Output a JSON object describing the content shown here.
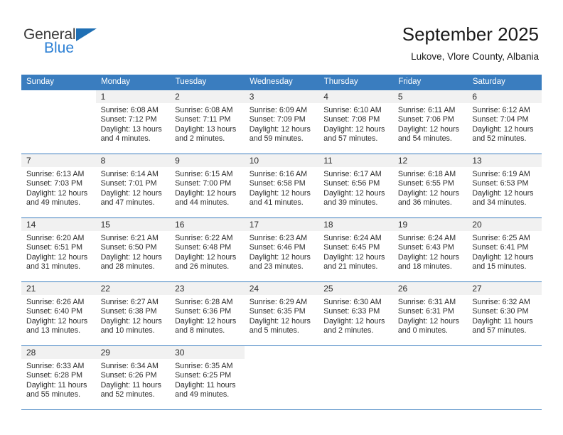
{
  "brand": {
    "name_top": "General",
    "name_bottom": "Blue",
    "accent_color": "#2b7fd4",
    "triangle_color": "#1f6fb4"
  },
  "header": {
    "title": "September 2025",
    "subtitle": "Lukove, Vlore County, Albania",
    "header_bg": "#3a7dbf",
    "header_text_color": "#ffffff"
  },
  "weekdays": [
    "Sunday",
    "Monday",
    "Tuesday",
    "Wednesday",
    "Thursday",
    "Friday",
    "Saturday"
  ],
  "weeks": [
    [
      {
        "day": "",
        "sunrise": "",
        "sunset": "",
        "daylight1": "",
        "daylight2": ""
      },
      {
        "day": "1",
        "sunrise": "Sunrise: 6:08 AM",
        "sunset": "Sunset: 7:12 PM",
        "daylight1": "Daylight: 13 hours",
        "daylight2": "and 4 minutes."
      },
      {
        "day": "2",
        "sunrise": "Sunrise: 6:08 AM",
        "sunset": "Sunset: 7:11 PM",
        "daylight1": "Daylight: 13 hours",
        "daylight2": "and 2 minutes."
      },
      {
        "day": "3",
        "sunrise": "Sunrise: 6:09 AM",
        "sunset": "Sunset: 7:09 PM",
        "daylight1": "Daylight: 12 hours",
        "daylight2": "and 59 minutes."
      },
      {
        "day": "4",
        "sunrise": "Sunrise: 6:10 AM",
        "sunset": "Sunset: 7:08 PM",
        "daylight1": "Daylight: 12 hours",
        "daylight2": "and 57 minutes."
      },
      {
        "day": "5",
        "sunrise": "Sunrise: 6:11 AM",
        "sunset": "Sunset: 7:06 PM",
        "daylight1": "Daylight: 12 hours",
        "daylight2": "and 54 minutes."
      },
      {
        "day": "6",
        "sunrise": "Sunrise: 6:12 AM",
        "sunset": "Sunset: 7:04 PM",
        "daylight1": "Daylight: 12 hours",
        "daylight2": "and 52 minutes."
      }
    ],
    [
      {
        "day": "7",
        "sunrise": "Sunrise: 6:13 AM",
        "sunset": "Sunset: 7:03 PM",
        "daylight1": "Daylight: 12 hours",
        "daylight2": "and 49 minutes."
      },
      {
        "day": "8",
        "sunrise": "Sunrise: 6:14 AM",
        "sunset": "Sunset: 7:01 PM",
        "daylight1": "Daylight: 12 hours",
        "daylight2": "and 47 minutes."
      },
      {
        "day": "9",
        "sunrise": "Sunrise: 6:15 AM",
        "sunset": "Sunset: 7:00 PM",
        "daylight1": "Daylight: 12 hours",
        "daylight2": "and 44 minutes."
      },
      {
        "day": "10",
        "sunrise": "Sunrise: 6:16 AM",
        "sunset": "Sunset: 6:58 PM",
        "daylight1": "Daylight: 12 hours",
        "daylight2": "and 41 minutes."
      },
      {
        "day": "11",
        "sunrise": "Sunrise: 6:17 AM",
        "sunset": "Sunset: 6:56 PM",
        "daylight1": "Daylight: 12 hours",
        "daylight2": "and 39 minutes."
      },
      {
        "day": "12",
        "sunrise": "Sunrise: 6:18 AM",
        "sunset": "Sunset: 6:55 PM",
        "daylight1": "Daylight: 12 hours",
        "daylight2": "and 36 minutes."
      },
      {
        "day": "13",
        "sunrise": "Sunrise: 6:19 AM",
        "sunset": "Sunset: 6:53 PM",
        "daylight1": "Daylight: 12 hours",
        "daylight2": "and 34 minutes."
      }
    ],
    [
      {
        "day": "14",
        "sunrise": "Sunrise: 6:20 AM",
        "sunset": "Sunset: 6:51 PM",
        "daylight1": "Daylight: 12 hours",
        "daylight2": "and 31 minutes."
      },
      {
        "day": "15",
        "sunrise": "Sunrise: 6:21 AM",
        "sunset": "Sunset: 6:50 PM",
        "daylight1": "Daylight: 12 hours",
        "daylight2": "and 28 minutes."
      },
      {
        "day": "16",
        "sunrise": "Sunrise: 6:22 AM",
        "sunset": "Sunset: 6:48 PM",
        "daylight1": "Daylight: 12 hours",
        "daylight2": "and 26 minutes."
      },
      {
        "day": "17",
        "sunrise": "Sunrise: 6:23 AM",
        "sunset": "Sunset: 6:46 PM",
        "daylight1": "Daylight: 12 hours",
        "daylight2": "and 23 minutes."
      },
      {
        "day": "18",
        "sunrise": "Sunrise: 6:24 AM",
        "sunset": "Sunset: 6:45 PM",
        "daylight1": "Daylight: 12 hours",
        "daylight2": "and 21 minutes."
      },
      {
        "day": "19",
        "sunrise": "Sunrise: 6:24 AM",
        "sunset": "Sunset: 6:43 PM",
        "daylight1": "Daylight: 12 hours",
        "daylight2": "and 18 minutes."
      },
      {
        "day": "20",
        "sunrise": "Sunrise: 6:25 AM",
        "sunset": "Sunset: 6:41 PM",
        "daylight1": "Daylight: 12 hours",
        "daylight2": "and 15 minutes."
      }
    ],
    [
      {
        "day": "21",
        "sunrise": "Sunrise: 6:26 AM",
        "sunset": "Sunset: 6:40 PM",
        "daylight1": "Daylight: 12 hours",
        "daylight2": "and 13 minutes."
      },
      {
        "day": "22",
        "sunrise": "Sunrise: 6:27 AM",
        "sunset": "Sunset: 6:38 PM",
        "daylight1": "Daylight: 12 hours",
        "daylight2": "and 10 minutes."
      },
      {
        "day": "23",
        "sunrise": "Sunrise: 6:28 AM",
        "sunset": "Sunset: 6:36 PM",
        "daylight1": "Daylight: 12 hours",
        "daylight2": "and 8 minutes."
      },
      {
        "day": "24",
        "sunrise": "Sunrise: 6:29 AM",
        "sunset": "Sunset: 6:35 PM",
        "daylight1": "Daylight: 12 hours",
        "daylight2": "and 5 minutes."
      },
      {
        "day": "25",
        "sunrise": "Sunrise: 6:30 AM",
        "sunset": "Sunset: 6:33 PM",
        "daylight1": "Daylight: 12 hours",
        "daylight2": "and 2 minutes."
      },
      {
        "day": "26",
        "sunrise": "Sunrise: 6:31 AM",
        "sunset": "Sunset: 6:31 PM",
        "daylight1": "Daylight: 12 hours",
        "daylight2": "and 0 minutes."
      },
      {
        "day": "27",
        "sunrise": "Sunrise: 6:32 AM",
        "sunset": "Sunset: 6:30 PM",
        "daylight1": "Daylight: 11 hours",
        "daylight2": "and 57 minutes."
      }
    ],
    [
      {
        "day": "28",
        "sunrise": "Sunrise: 6:33 AM",
        "sunset": "Sunset: 6:28 PM",
        "daylight1": "Daylight: 11 hours",
        "daylight2": "and 55 minutes."
      },
      {
        "day": "29",
        "sunrise": "Sunrise: 6:34 AM",
        "sunset": "Sunset: 6:26 PM",
        "daylight1": "Daylight: 11 hours",
        "daylight2": "and 52 minutes."
      },
      {
        "day": "30",
        "sunrise": "Sunrise: 6:35 AM",
        "sunset": "Sunset: 6:25 PM",
        "daylight1": "Daylight: 11 hours",
        "daylight2": "and 49 minutes."
      },
      {
        "day": "",
        "sunrise": "",
        "sunset": "",
        "daylight1": "",
        "daylight2": ""
      },
      {
        "day": "",
        "sunrise": "",
        "sunset": "",
        "daylight1": "",
        "daylight2": ""
      },
      {
        "day": "",
        "sunrise": "",
        "sunset": "",
        "daylight1": "",
        "daylight2": ""
      },
      {
        "day": "",
        "sunrise": "",
        "sunset": "",
        "daylight1": "",
        "daylight2": ""
      }
    ]
  ]
}
